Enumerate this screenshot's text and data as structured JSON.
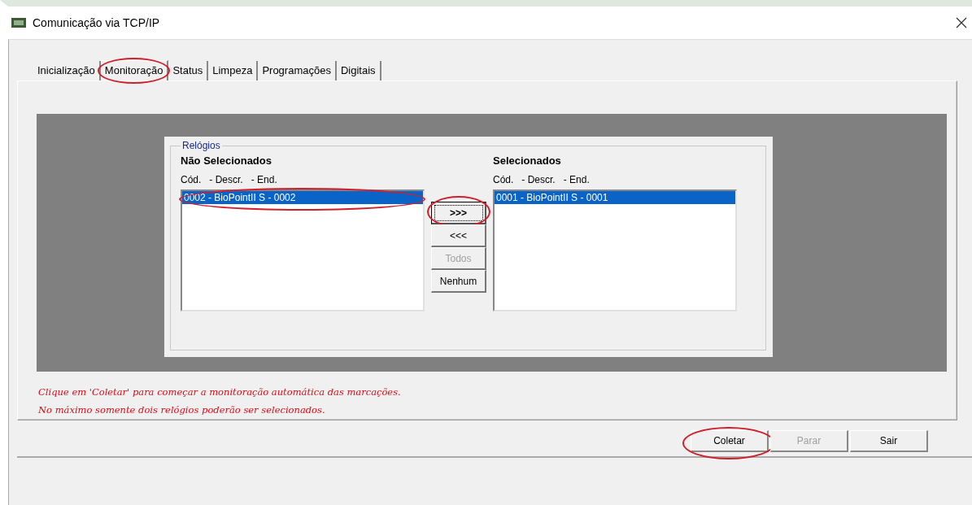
{
  "window": {
    "title": "Comunicação via TCP/IP"
  },
  "tabs": [
    {
      "label": "Inicialização",
      "selected": false,
      "circled": false
    },
    {
      "label": "Monitoração",
      "selected": true,
      "circled": true
    },
    {
      "label": "Status",
      "selected": false,
      "circled": false
    },
    {
      "label": "Limpeza",
      "selected": false,
      "circled": false
    },
    {
      "label": "Programações",
      "selected": false,
      "circled": false
    },
    {
      "label": "Digitais",
      "selected": false,
      "circled": false
    }
  ],
  "group": {
    "title": "Relógios",
    "lists": [
      {
        "heading": "Não Selecionados",
        "columns": [
          "Cód.",
          "- Descr.",
          "- End."
        ],
        "items": [
          {
            "text": "0002 - BioPointII S - 0002",
            "selected": true,
            "circled": true
          }
        ]
      },
      {
        "heading": "Selecionados",
        "columns": [
          "Cód.",
          "- Descr.",
          "- End."
        ],
        "items": [
          {
            "text": "0001 - BioPointII S - 0001",
            "selected": true,
            "circled": false
          }
        ]
      }
    ],
    "transfer_buttons": [
      {
        "label": ">>>",
        "disabled": false,
        "focused": true,
        "circled": true
      },
      {
        "label": "<<<",
        "disabled": false,
        "focused": false,
        "circled": false
      },
      {
        "label": "Todos",
        "disabled": true,
        "focused": false,
        "circled": false
      },
      {
        "label": "Nenhum",
        "disabled": false,
        "focused": false,
        "circled": false
      }
    ]
  },
  "messages": [
    "Clique em 'Coletar' para começar a monitoração automática das marcações.",
    "No máximo somente dois relógios poderão ser selecionados."
  ],
  "buttons": [
    {
      "label": "Coletar",
      "disabled": false,
      "circled": true
    },
    {
      "label": "Parar",
      "disabled": true,
      "circled": false
    },
    {
      "label": "Sair",
      "disabled": false,
      "circled": false
    }
  ]
}
